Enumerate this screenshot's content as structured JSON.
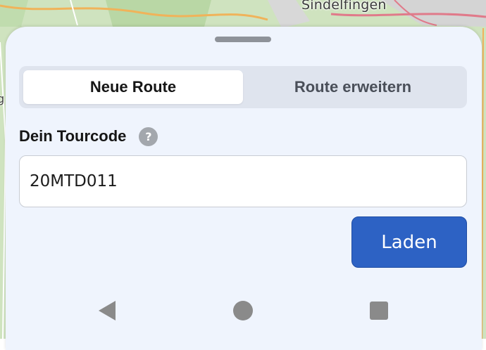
{
  "map": {
    "place_label": "Sindelfingen",
    "edge_label_left": "g"
  },
  "sheet": {
    "tabs": [
      {
        "label": "Neue Route",
        "active": true
      },
      {
        "label": "Route erweitern",
        "active": false
      }
    ],
    "field": {
      "label": "Dein Tourcode",
      "help_icon": "question-circle-icon",
      "value": "20MTD011"
    },
    "load_button_label": "Laden"
  },
  "navbar": {
    "back_icon": "triangle-back-icon",
    "home_icon": "circle-home-icon",
    "recent_icon": "square-recents-icon"
  },
  "colors": {
    "accent": "#2d62c4",
    "sheet_background": "#eff4fd",
    "segmented_background": "#dfe4ee",
    "map_background": "#cfe3bf"
  }
}
